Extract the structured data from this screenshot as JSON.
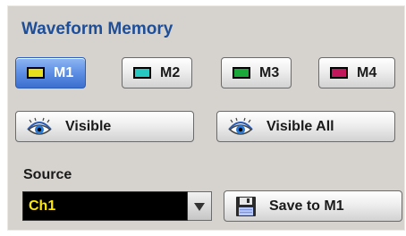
{
  "panel": {
    "title": "Waveform Memory",
    "memories": [
      {
        "label": "M1",
        "color": "#e8df1c",
        "selected": true
      },
      {
        "label": "M2",
        "color": "#27c8c2",
        "selected": false
      },
      {
        "label": "M3",
        "color": "#1aa83a",
        "selected": false
      },
      {
        "label": "M4",
        "color": "#c2185b",
        "selected": false
      }
    ],
    "visible_label": "Visible",
    "visible_all_label": "Visible All",
    "source_label": "Source",
    "source_value": "Ch1",
    "save_label": "Save to M1",
    "icons": {
      "visible": "eye-icon",
      "visible_all": "eye-icon",
      "dropdown": "triangle-down-icon",
      "save": "floppy-disk-icon"
    },
    "colors": {
      "title": "#1f4e99",
      "source_text": "#ffe800",
      "active_button": "#5e8fe4"
    }
  }
}
